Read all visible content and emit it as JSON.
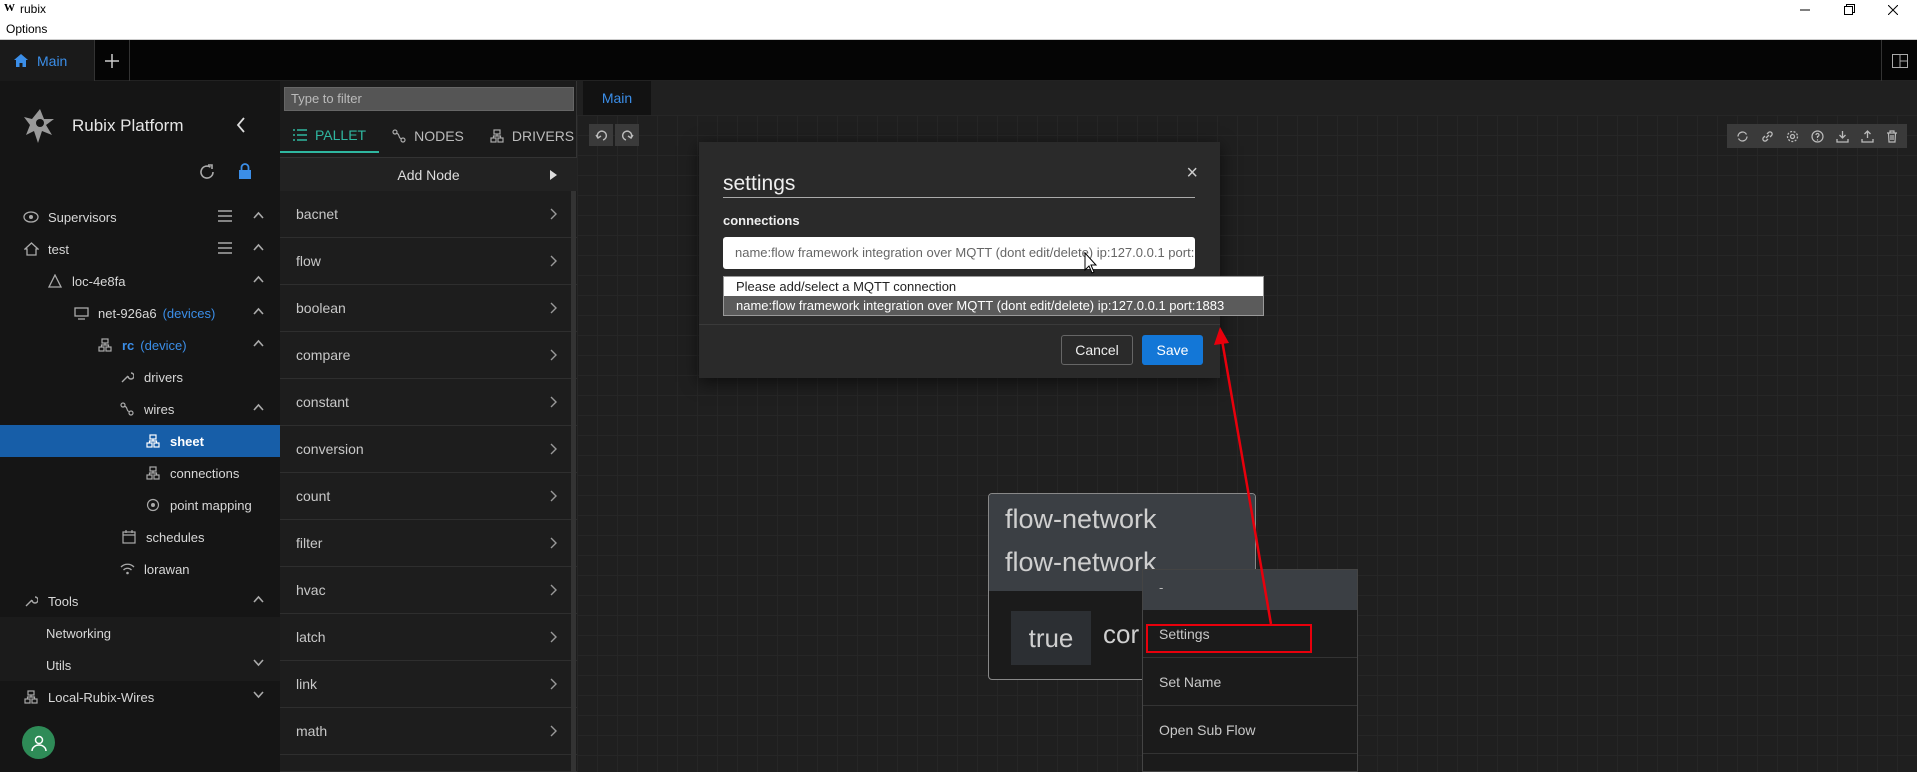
{
  "window": {
    "app_logo": "W",
    "title": "rubix",
    "menu": "Options"
  },
  "tabs": {
    "main_label": "Main",
    "add_icon": "plus-icon"
  },
  "sidebar": {
    "brand": "Rubix Platform",
    "tree": [
      {
        "label": "Supervisors",
        "sub": ""
      },
      {
        "label": "test",
        "sub": ""
      },
      {
        "label": "loc-4e8fa",
        "sub": ""
      },
      {
        "label": "net-926a6",
        "sub": "(devices)"
      },
      {
        "label": "rc",
        "sub": "(device)"
      },
      {
        "label": "drivers",
        "sub": ""
      },
      {
        "label": "wires",
        "sub": ""
      },
      {
        "label": "sheet",
        "sub": ""
      },
      {
        "label": "connections",
        "sub": ""
      },
      {
        "label": "point mapping",
        "sub": ""
      },
      {
        "label": "schedules",
        "sub": ""
      },
      {
        "label": "lorawan",
        "sub": ""
      },
      {
        "label": "Tools",
        "sub": ""
      },
      {
        "label": "Networking",
        "sub": ""
      },
      {
        "label": "Utils",
        "sub": ""
      },
      {
        "label": "Local-Rubix-Wires",
        "sub": ""
      }
    ]
  },
  "palette": {
    "filter_placeholder": "Type to filter",
    "tabs": [
      "PALLET",
      "NODES",
      "DRIVERS"
    ],
    "add_node": "Add Node",
    "categories": [
      "bacnet",
      "flow",
      "boolean",
      "compare",
      "constant",
      "conversion",
      "count",
      "filter",
      "hvac",
      "latch",
      "link",
      "math"
    ]
  },
  "editor": {
    "tab": "Main"
  },
  "node": {
    "title1": "flow-network",
    "title2": "flow-network",
    "value": "true",
    "partial": "cor"
  },
  "context_menu": {
    "header": "-",
    "items": [
      "Settings",
      "Set Name",
      "Open Sub Flow"
    ]
  },
  "dialog": {
    "title": "settings",
    "close": "×",
    "label": "connections",
    "selected": "name:flow framework integration over MQTT (dont edit/delete) ip:127.0.0.1 port:1883",
    "options": [
      "Please add/select a MQTT connection",
      "name:flow framework integration over MQTT (dont edit/delete) ip:127.0.0.1 port:1883"
    ],
    "cancel": "Cancel",
    "save": "Save"
  },
  "colors": {
    "accent": "#3b8ee8",
    "active_row": "#175ea8",
    "pallet_accent": "#2fb7a0",
    "save": "#1377d7",
    "annotation": "#e8000c"
  }
}
